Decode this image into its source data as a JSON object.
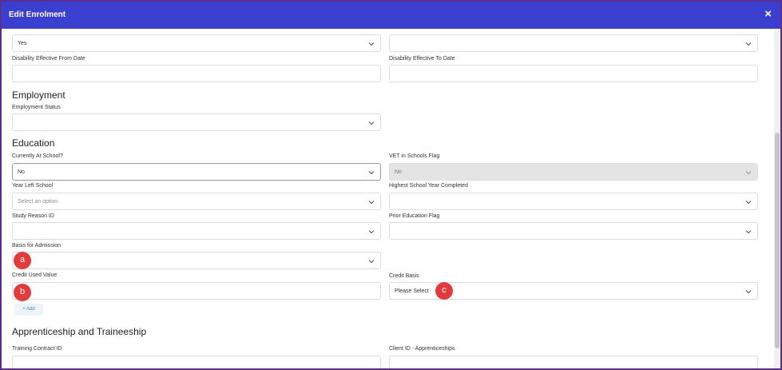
{
  "modal": {
    "title": "Edit Enrolment",
    "close_symbol": "×"
  },
  "fields": {
    "disability_flag": {
      "value": "Yes"
    },
    "disability_right": {
      "value": ""
    },
    "disability_from_label": "Disability Effective From Date",
    "disability_to_label": "Disability Effective To Date",
    "employment_status_label": "Employment Status",
    "currently_at_school_label": "Currently At School?",
    "currently_at_school_value": "No",
    "vet_flag_label": "VET in Schools Flag",
    "vet_flag_value": "No",
    "year_left_label": "Year Left School",
    "year_left_placeholder": "Select an option",
    "highest_year_label": "Highest School Year Completed",
    "study_reason_label": "Study Reason ID",
    "prior_education_label": "Prior Education Flag",
    "basis_admission_label": "Basis for Admission",
    "credit_used_label": "Credit Used Value",
    "credit_basis_label": "Credit Basis",
    "credit_basis_value": "Please Select",
    "training_contract_label": "Training Contract ID",
    "client_id_label": "Client ID - Apprenticeships"
  },
  "sections": {
    "employment": "Employment",
    "education": "Education",
    "apprenticeship": "Apprenticeship and Traineeship"
  },
  "add_button": "+ Add",
  "markers": {
    "a": "a",
    "b": "b",
    "c": "c"
  },
  "colors": {
    "header": "#3b3fd0",
    "marker": "#e33b3b",
    "outer": "#5b2d8e"
  }
}
